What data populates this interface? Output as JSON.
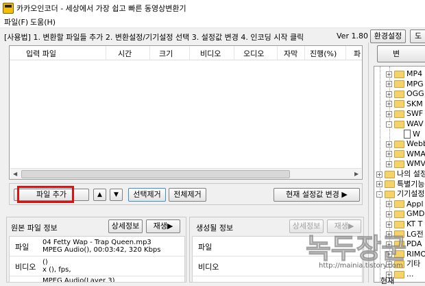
{
  "window": {
    "title": "카카오인코더 - 세상에서 가장 쉽고 빠른 동영상변환기"
  },
  "menu": [
    "파일(F)",
    "도움(H)"
  ],
  "usage": {
    "text": "[사용법] 1. 변환할 파일들 추가  2. 변환설정/기기설정 선택  3. 설정값 변경  4. 인코딩 시작 클릭",
    "version": "Ver 1.80"
  },
  "top_buttons": {
    "settings": "환경설정",
    "partial": "도"
  },
  "file_list": {
    "columns": [
      "입력 파일",
      "시간",
      "크기",
      "비디오",
      "오디오",
      "자막",
      "진행(%)",
      "파"
    ]
  },
  "toolbar": {
    "add_file": "파일 추가",
    "up": "▲",
    "down": "▼",
    "remove_selected": "선택제거",
    "remove_all": "전체제거",
    "change_settings": "현재 설정값 변경 ▶"
  },
  "source_info": {
    "title": "원본 파일 정보",
    "detail_button": "상세정보",
    "play_button": "재생▶",
    "rows": [
      {
        "label": "파일",
        "lines": [
          "04 Fetty Wap - Trap Queen.mp3",
          "MPEG Audio(), 00:03:42, 320 Kbps"
        ]
      },
      {
        "label": "비디오",
        "lines": [
          "()",
          "x (), fps,"
        ]
      },
      {
        "label": "",
        "lines": [
          "MPEG Audio(Layer 3)"
        ]
      }
    ]
  },
  "output_info": {
    "title": "생성될 정보",
    "detail_button": "상세정보",
    "play_button": "재생▶",
    "rows": [
      {
        "label": "파일"
      },
      {
        "label": "비디오"
      }
    ]
  },
  "right_panel": {
    "top_button": "변",
    "tree": [
      {
        "indent": 1,
        "exp": "+",
        "icon": "folder",
        "label": "MP4"
      },
      {
        "indent": 1,
        "exp": "+",
        "icon": "folder",
        "label": "MPG"
      },
      {
        "indent": 1,
        "exp": "+",
        "icon": "folder",
        "label": "OGG"
      },
      {
        "indent": 1,
        "exp": "+",
        "icon": "folder",
        "label": "SKM"
      },
      {
        "indent": 1,
        "exp": "+",
        "icon": "folder",
        "label": "SWF"
      },
      {
        "indent": 1,
        "exp": "-",
        "icon": "folder",
        "label": "WAV"
      },
      {
        "indent": 2,
        "exp": "",
        "icon": "doc",
        "label": "W"
      },
      {
        "indent": 1,
        "exp": "+",
        "icon": "folder",
        "label": "Webb"
      },
      {
        "indent": 1,
        "exp": "+",
        "icon": "folder",
        "label": "WMA"
      },
      {
        "indent": 1,
        "exp": "+",
        "icon": "folder",
        "label": "WMV"
      },
      {
        "indent": 0,
        "exp": "+",
        "icon": "folder",
        "label": "나의 설정"
      },
      {
        "indent": 0,
        "exp": "+",
        "icon": "folder",
        "label": "특별기능"
      },
      {
        "indent": 0,
        "exp": "-",
        "icon": "folder",
        "label": "기기설정"
      },
      {
        "indent": 1,
        "exp": "+",
        "icon": "folder",
        "label": "Appl"
      },
      {
        "indent": 1,
        "exp": "+",
        "icon": "folder",
        "label": "GMD"
      },
      {
        "indent": 1,
        "exp": "+",
        "icon": "folder",
        "label": "KT T"
      },
      {
        "indent": 1,
        "exp": "+",
        "icon": "folder",
        "label": "LG전"
      },
      {
        "indent": 1,
        "exp": "+",
        "icon": "folder",
        "label": "PDA"
      },
      {
        "indent": 1,
        "exp": "+",
        "icon": "folder",
        "label": "RIMO"
      },
      {
        "indent": 1,
        "exp": "+",
        "icon": "folder",
        "label": "기타"
      },
      {
        "indent": 1,
        "exp": "+",
        "icon": "folder",
        "label": "..."
      }
    ],
    "bottom_label": "현재"
  },
  "watermark": {
    "text": "녹두장군",
    "url": "http://mainia.tistory.com"
  },
  "colors": {
    "highlight": "#e01010",
    "folder": "#f6d36a",
    "app_icon": "#f2c000"
  }
}
